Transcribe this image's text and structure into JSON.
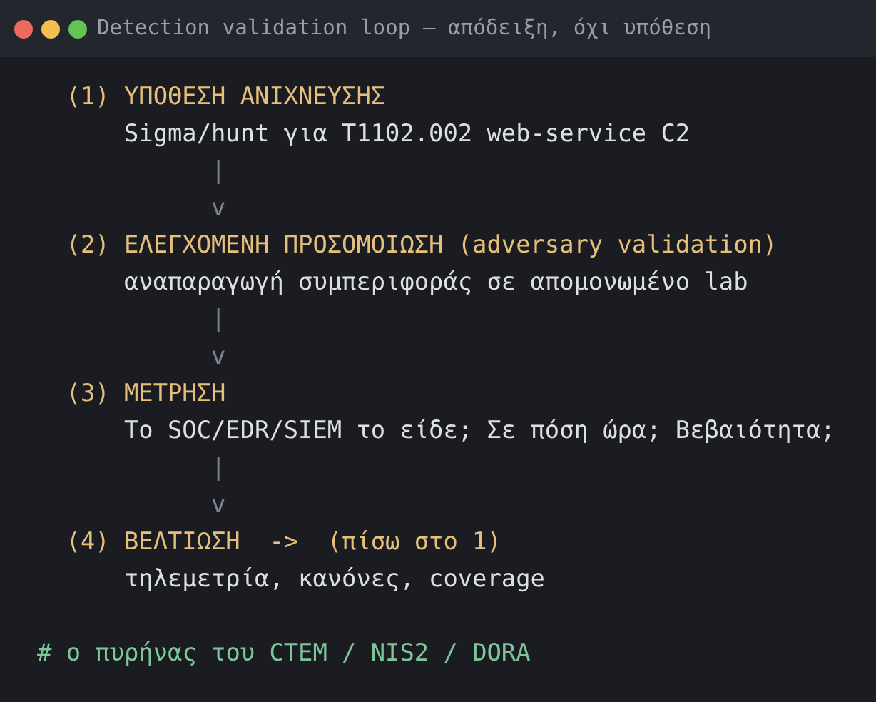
{
  "window": {
    "title": "Detection validation loop — απόδειξη, όχι υπόθεση"
  },
  "steps": [
    {
      "heading": "(1) ΥΠΟΘΕΣΗ ΑΝΙΧΝΕΥΣΗΣ",
      "detail": "Sigma/hunt για T1102.002 web-service C2",
      "connector": [
        "|",
        "v"
      ]
    },
    {
      "heading": "(2) ΕΛΕΓΧΟΜΕΝΗ ΠΡΟΣΟΜΟΙΩΣΗ (adversary validation)",
      "detail": "αναπαραγωγή συμπεριφοράς σε απομονωμένο lab",
      "connector": [
        "|",
        "v"
      ]
    },
    {
      "heading": "(3) ΜΕΤΡΗΣΗ",
      "detail": "Το SOC/EDR/SIEM το είδε; Σε πόση ώρα; Βεβαιότητα;",
      "connector": [
        "|",
        "v"
      ]
    },
    {
      "heading": "(4) ΒΕΛΤΙΩΣΗ  ->  (πίσω στο 1)",
      "detail": "τηλεμετρία, κανόνες, coverage"
    }
  ],
  "comment": "# ο πυρήνας του CTEM / NIS2 / DORA"
}
